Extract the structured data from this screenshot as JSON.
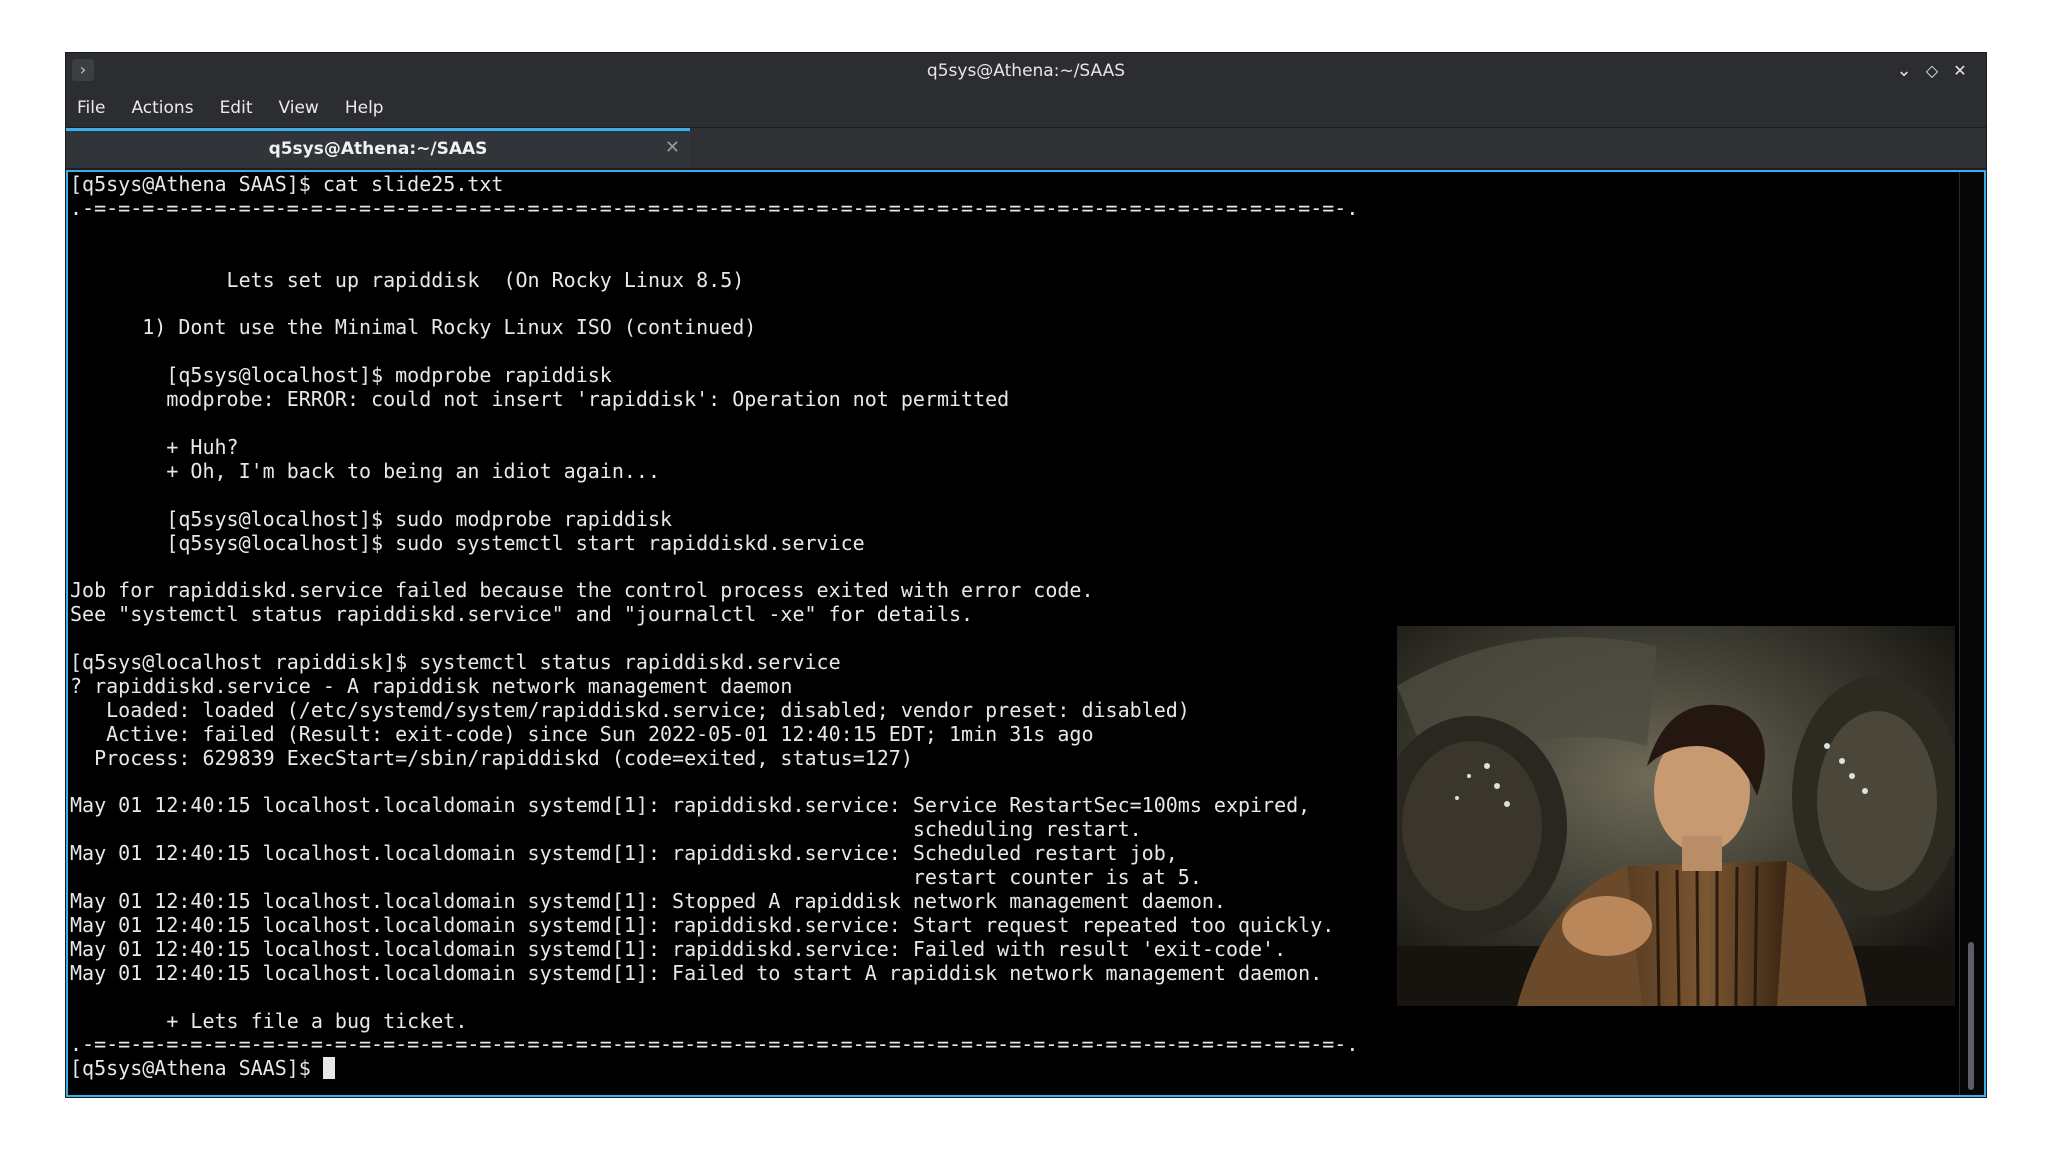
{
  "window": {
    "title": "q5sys@Athena:~/SAAS",
    "menu_button_glyph": "›",
    "controls": {
      "minimize_glyph": "⌄",
      "maximize_glyph": "◇",
      "close_glyph": "✕"
    }
  },
  "menubar": {
    "items": [
      "File",
      "Actions",
      "Edit",
      "View",
      "Help"
    ]
  },
  "tabs": [
    {
      "label": "q5sys@Athena:~/SAAS",
      "close_glyph": "✕",
      "active": true
    }
  ],
  "terminal": {
    "lines": [
      "[q5sys@Athena SAAS]$ cat slide25.txt",
      ".-=-=-=-=-=-=-=-=-=-=-=-=-=-=-=-=-=-=-=-=-=-=-=-=-=-=-=-=-=-=-=-=-=-=-=-=-=-=-=-=-=-=-=-=-=-=-=-=-=-=-=-=-.",
      "",
      "",
      "             Lets set up rapiddisk  (On Rocky Linux 8.5)",
      "",
      "      1) Dont use the Minimal Rocky Linux ISO (continued)",
      "",
      "        [q5sys@localhost]$ modprobe rapiddisk",
      "        modprobe: ERROR: could not insert 'rapiddisk': Operation not permitted",
      "",
      "        + Huh?",
      "        + Oh, I'm back to being an idiot again...",
      "",
      "        [q5sys@localhost]$ sudo modprobe rapiddisk",
      "        [q5sys@localhost]$ sudo systemctl start rapiddiskd.service",
      "",
      "Job for rapiddiskd.service failed because the control process exited with error code.",
      "See \"systemctl status rapiddiskd.service\" and \"journalctl -xe\" for details.",
      "",
      "[q5sys@localhost rapiddisk]$ systemctl status rapiddiskd.service",
      "? rapiddiskd.service - A rapiddisk network management daemon",
      "   Loaded: loaded (/etc/systemd/system/rapiddiskd.service; disabled; vendor preset: disabled)",
      "   Active: failed (Result: exit-code) since Sun 2022-05-01 12:40:15 EDT; 1min 31s ago",
      "  Process: 629839 ExecStart=/sbin/rapiddiskd (code=exited, status=127)",
      "",
      "May 01 12:40:15 localhost.localdomain systemd[1]: rapiddiskd.service: Service RestartSec=100ms expired,",
      "                                                                      scheduling restart.",
      "May 01 12:40:15 localhost.localdomain systemd[1]: rapiddiskd.service: Scheduled restart job,",
      "                                                                      restart counter is at 5.",
      "May 01 12:40:15 localhost.localdomain systemd[1]: Stopped A rapiddisk network management daemon.",
      "May 01 12:40:15 localhost.localdomain systemd[1]: rapiddiskd.service: Start request repeated too quickly.",
      "May 01 12:40:15 localhost.localdomain systemd[1]: rapiddiskd.service: Failed with result 'exit-code'.",
      "May 01 12:40:15 localhost.localdomain systemd[1]: Failed to start A rapiddisk network management daemon.",
      "",
      "        + Lets file a bug ticket.",
      ".-=-=-=-=-=-=-=-=-=-=-=-=-=-=-=-=-=-=-=-=-=-=-=-=-=-=-=-=-=-=-=-=-=-=-=-=-=-=-=-=-=-=-=-=-=-=-=-=-=-=-=-=-."
    ],
    "prompt": "[q5sys@Athena SAAS]$ "
  },
  "colors": {
    "accent": "#3daee9",
    "terminal_bg": "#000000",
    "terminal_fg": "#e8e8e8",
    "chrome_bg": "#2b2d30"
  }
}
